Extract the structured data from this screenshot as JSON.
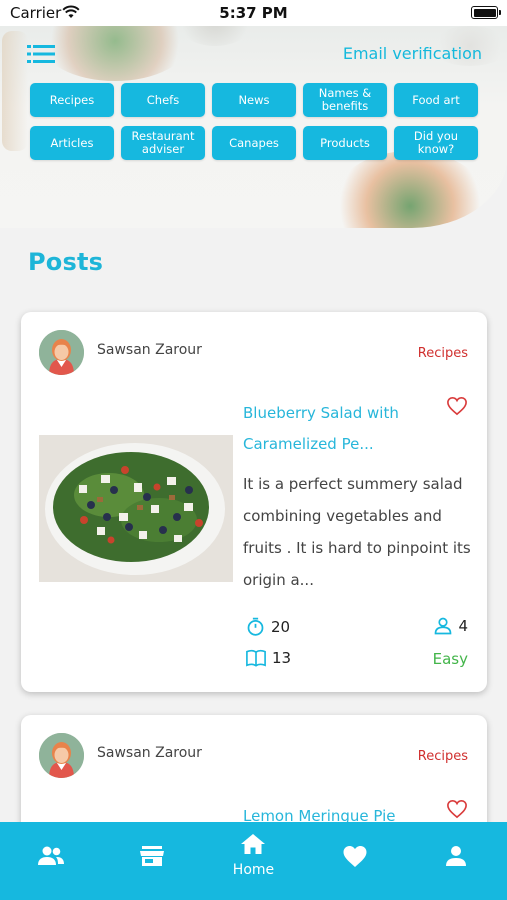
{
  "status_bar": {
    "carrier": "Carrier",
    "time": "5:37 PM"
  },
  "header": {
    "email_verification": "Email verification",
    "categories": [
      "Recipes",
      "Chefs",
      "News",
      "Names & benefits",
      "Food art",
      "Articles",
      "Restaurant adviser",
      "Canapes",
      "Products",
      "Did you know?"
    ]
  },
  "section_title": "Posts",
  "posts": [
    {
      "author": "Sawsan Zarour",
      "category": "Recipes",
      "title": "Blueberry Salad with Caramelized Pe...",
      "description": "It is a perfect summery salad combining vegetables and fruits . It is hard to pinpoint its origin a...",
      "time": "20",
      "servings": "4",
      "steps": "13",
      "difficulty": "Easy"
    },
    {
      "author": "Sawsan Zarour",
      "category": "Recipes",
      "title": "Lemon Meringue Pie"
    }
  ],
  "bottom_nav": [
    {
      "icon": "users-icon"
    },
    {
      "icon": "store-icon"
    },
    {
      "icon": "home-icon",
      "label": "Home"
    },
    {
      "icon": "heart-icon"
    },
    {
      "icon": "person-icon"
    }
  ],
  "colors": {
    "accent": "#16b8df",
    "category_red": "#d0302f",
    "easy_green": "#43b54a"
  }
}
